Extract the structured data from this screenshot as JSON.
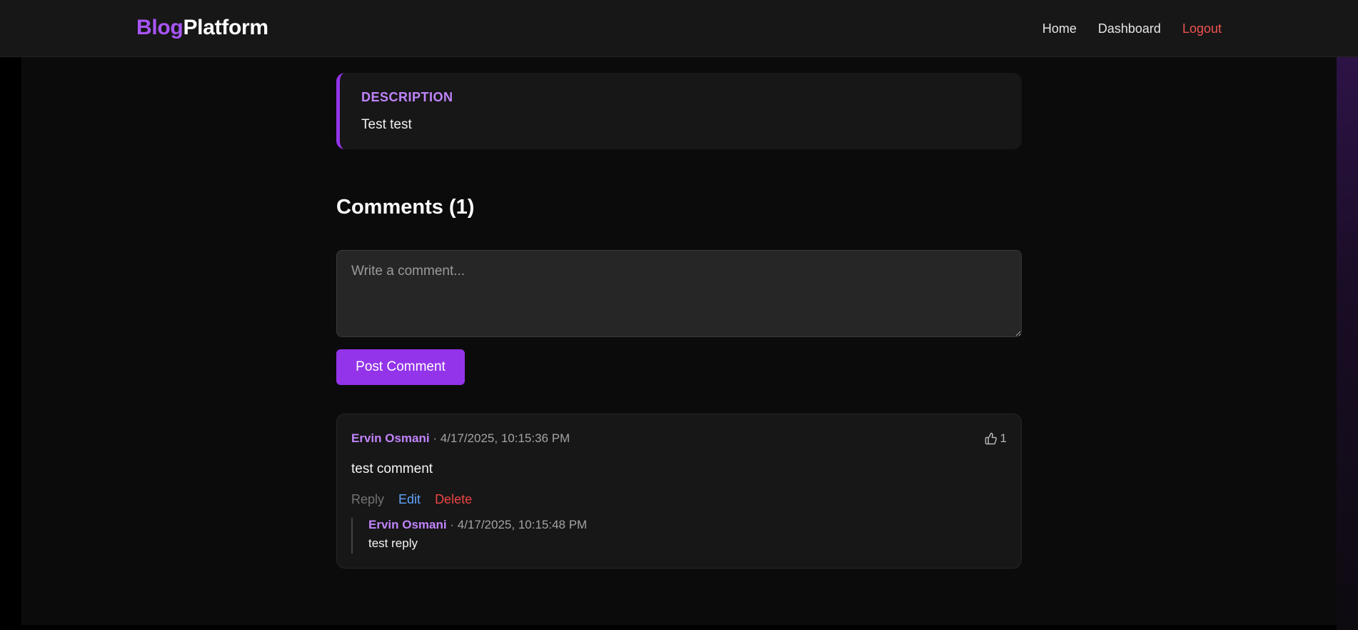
{
  "nav": {
    "brand_part1": "Blog",
    "brand_part2": "Platform",
    "links": [
      "Home",
      "Dashboard",
      "Logout"
    ]
  },
  "description": {
    "label": "DESCRIPTION",
    "text": "Test test"
  },
  "comments": {
    "heading": "Comments (1)",
    "input_placeholder": "Write a comment...",
    "post_button": "Post Comment",
    "items": [
      {
        "author": "Ervin Osmani",
        "separator": "·",
        "timestamp": "4/17/2025, 10:15:36 PM",
        "likes": "1",
        "body": "test comment",
        "actions": [
          "Reply",
          "Edit",
          "Delete"
        ],
        "replies": [
          {
            "author": "Ervin Osmani",
            "separator": "·",
            "timestamp": "4/17/2025, 10:15:48 PM",
            "body": "test reply"
          }
        ]
      }
    ]
  },
  "colors": {
    "accent": "#9333ea",
    "accent_light": "#c084fc",
    "logout": "#f05252",
    "edit": "#60a5fa",
    "delete": "#ef4444"
  },
  "icons": {
    "like": "thumbs-up-icon"
  }
}
